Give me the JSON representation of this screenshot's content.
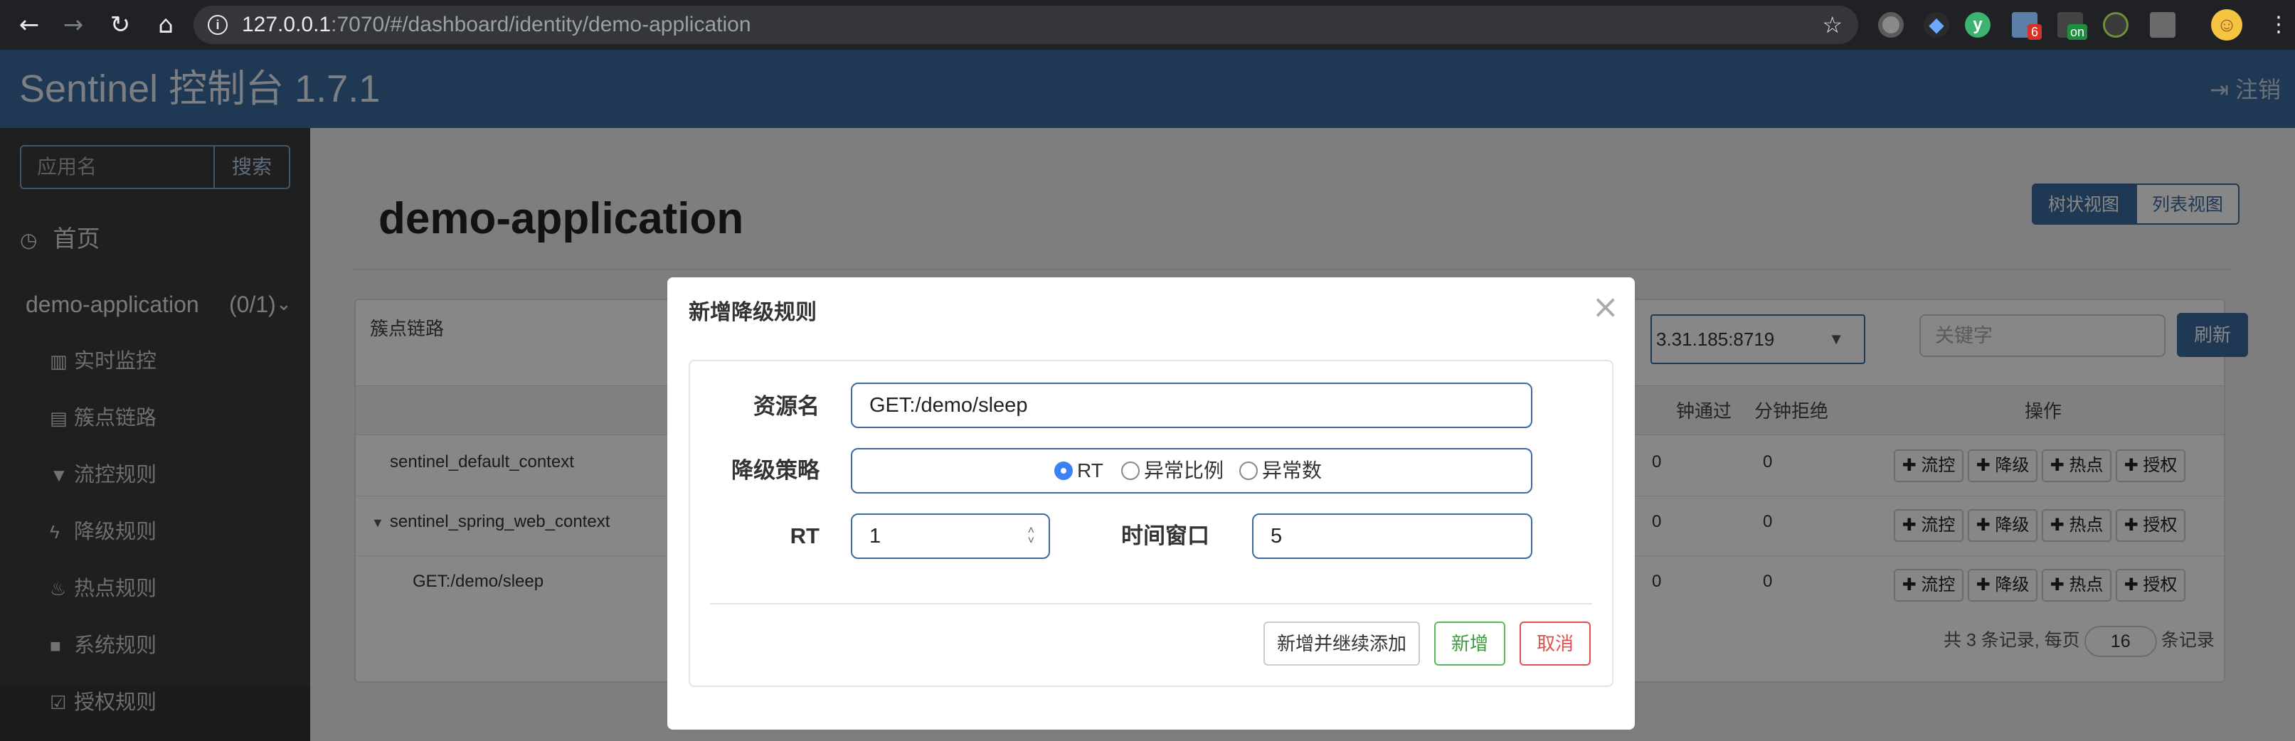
{
  "browser": {
    "url_host": "127.0.0.1",
    "url_path": ":7070/#/dashboard/identity/demo-application",
    "ext_badges": {
      "badge1": "6",
      "badge2": "on"
    }
  },
  "header": {
    "brand": "Sentinel 控制台 1.7.1",
    "logout": "注销"
  },
  "sidebar": {
    "search_placeholder": "应用名",
    "search_button": "搜索",
    "home": "首页",
    "app_name": "demo-application",
    "app_count": "(0/1)",
    "items": [
      {
        "icon": "bar-chart-icon",
        "label": "实时监控"
      },
      {
        "icon": "list-icon",
        "label": "簇点链路"
      },
      {
        "icon": "filter-icon",
        "label": "流控规则"
      },
      {
        "icon": "bolt-icon",
        "label": "降级规则"
      },
      {
        "icon": "fire-icon",
        "label": "热点规则"
      },
      {
        "icon": "lock-icon",
        "label": "系统规则"
      },
      {
        "icon": "check-square-icon",
        "label": "授权规则"
      }
    ]
  },
  "main": {
    "title": "demo-application",
    "view_tree": "树状视图",
    "view_list": "列表视图",
    "panel_title": "簇点链路",
    "machine": "3.31.185:8719",
    "keyword_placeholder": "关键字",
    "refresh": "刷新",
    "columns": {
      "pass": "钟通过",
      "block": "分钟拒绝",
      "ops": "操作"
    },
    "rows": [
      {
        "name": "sentinel_default_context",
        "pass": "0",
        "block": "0"
      },
      {
        "name": "sentinel_spring_web_context",
        "pass": "0",
        "block": "0"
      },
      {
        "name": "GET:/demo/sleep",
        "pass": "0",
        "block": "0"
      }
    ],
    "op_labels": {
      "flow": "流控",
      "degrade": "降级",
      "hot": "热点",
      "auth": "授权"
    },
    "pager": {
      "prefix": "共 3 条记录, 每页",
      "page_size": "16",
      "suffix": "条记录"
    }
  },
  "modal": {
    "title": "新增降级规则",
    "resource_label": "资源名",
    "resource_value": "GET:/demo/sleep",
    "strategy_label": "降级策略",
    "strategies": [
      "RT",
      "异常比例",
      "异常数"
    ],
    "selected_strategy": "RT",
    "rt_label": "RT",
    "rt_value": "1",
    "window_label": "时间窗口",
    "window_value": "5",
    "btn_add_continue": "新增并继续添加",
    "btn_add": "新增",
    "btn_cancel": "取消"
  },
  "colors": {
    "header_blue": "#3c6a9f",
    "success_green": "#5cb85c",
    "danger_red": "#d9534f",
    "radio_blue": "#3b82f6"
  }
}
